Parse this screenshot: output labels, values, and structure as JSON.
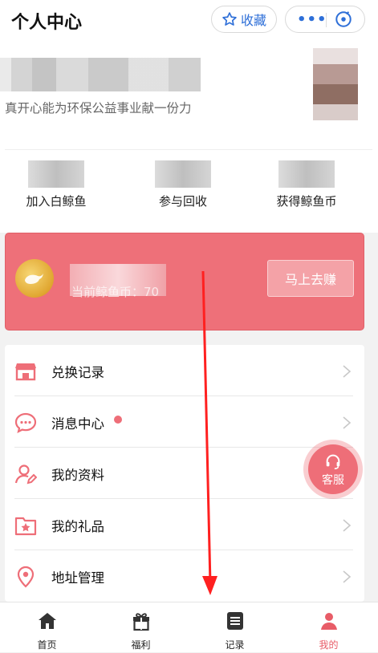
{
  "header": {
    "title": "个人中心",
    "favorite_label": "收藏",
    "more_label": "•••"
  },
  "profile": {
    "slogan": "真开心能为环保公益事业献一份力",
    "stats": [
      {
        "label": "加入白鲸鱼"
      },
      {
        "label": "参与回收"
      },
      {
        "label": "获得鲸鱼币"
      }
    ]
  },
  "coin": {
    "text": "当前鲸鱼币：70",
    "earn_label": "马上去赚"
  },
  "menu": {
    "items": [
      {
        "label": "兑换记录",
        "icon": "store-icon"
      },
      {
        "label": "消息中心",
        "icon": "chat-icon",
        "badge": true
      },
      {
        "label": "我的资料",
        "icon": "user-edit-icon"
      },
      {
        "label": "我的礼品",
        "icon": "gift-folder-icon"
      },
      {
        "label": "地址管理",
        "icon": "location-icon"
      }
    ]
  },
  "service": {
    "label": "客服"
  },
  "tabbar": {
    "tabs": [
      {
        "label": "首页",
        "icon": "home-icon"
      },
      {
        "label": "福利",
        "icon": "gift-icon"
      },
      {
        "label": "记录",
        "icon": "list-icon"
      },
      {
        "label": "我的",
        "icon": "profile-icon",
        "active": true
      }
    ]
  },
  "colors": {
    "accent": "#ee7079",
    "link": "#2e6fd8",
    "annotation_arrow": "#ff2020"
  }
}
